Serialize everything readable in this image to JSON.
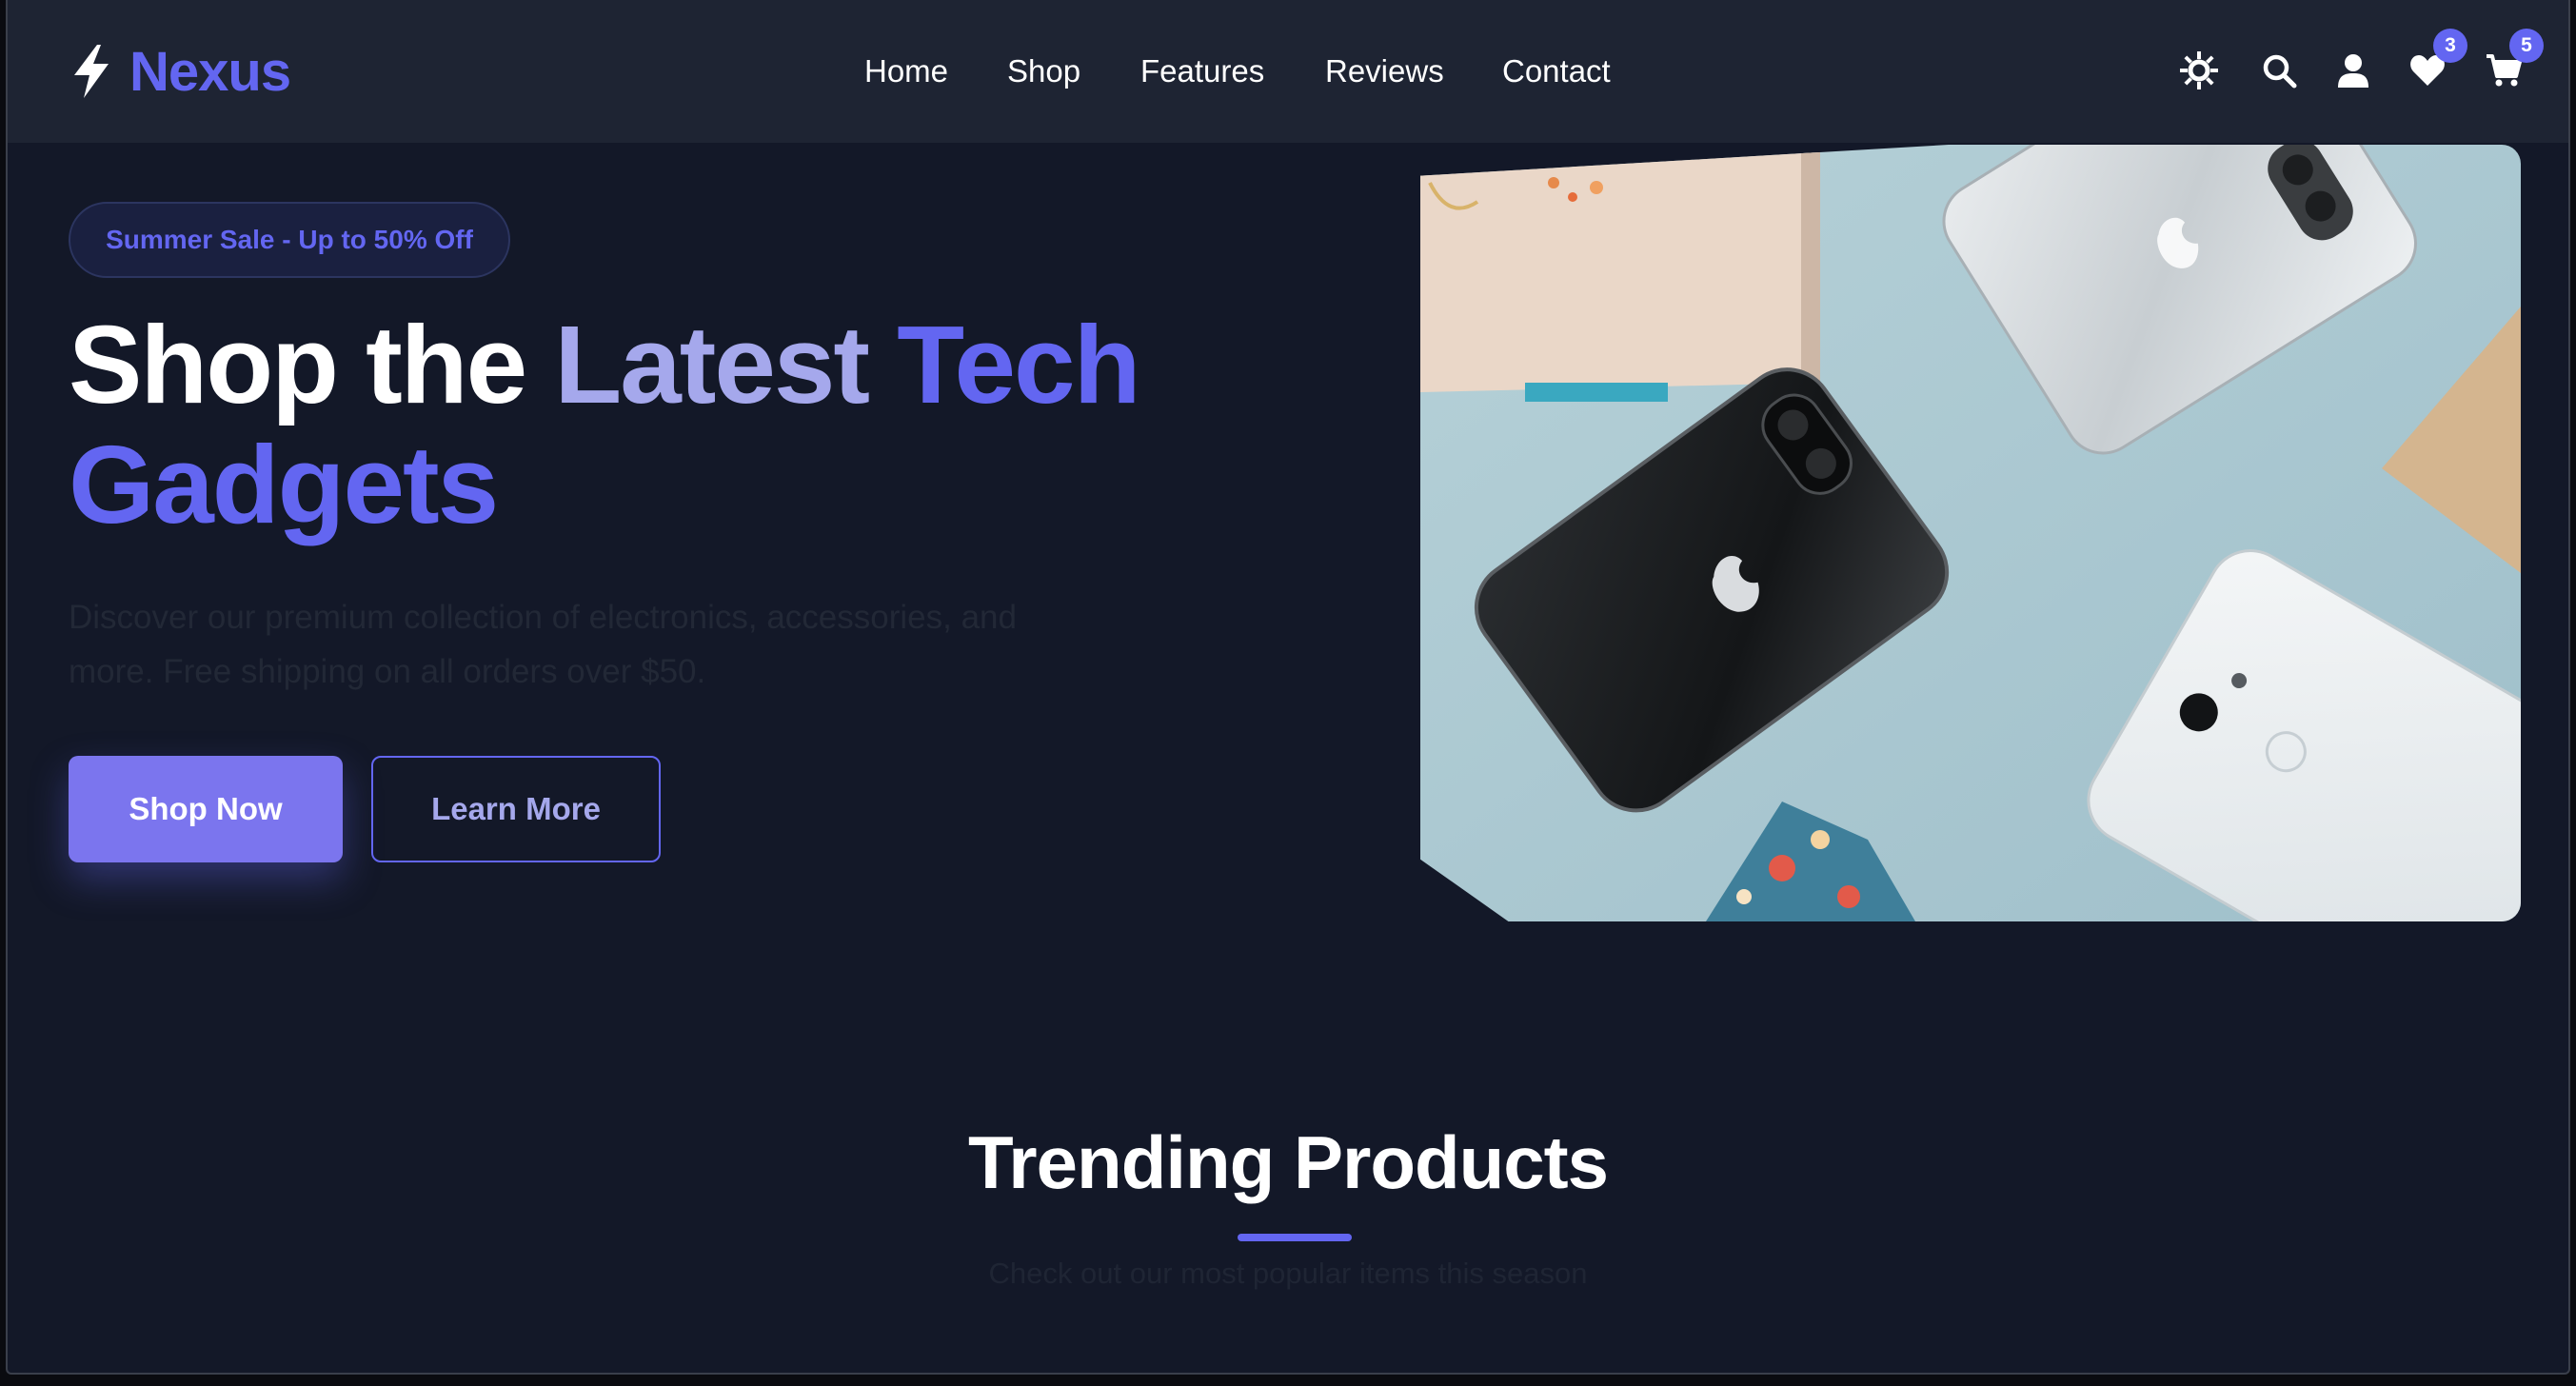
{
  "brand": {
    "name": "Nexus",
    "accent": "#6366f1"
  },
  "nav": {
    "links": [
      "Home",
      "Shop",
      "Features",
      "Reviews",
      "Contact"
    ],
    "icons": [
      "theme-toggle-icon",
      "search-icon",
      "user-icon",
      "heart-icon",
      "cart-icon"
    ],
    "wishlist_count": "3",
    "cart_count": "5"
  },
  "hero": {
    "badge": "Summer Sale - Up to 50% Off",
    "title_part1": "Shop the ",
    "title_part2": "Latest ",
    "title_part3": "Tech",
    "title_part4": "Gadgets",
    "description": "Discover our premium collection of electronics, accessories, and more. Free shipping on all orders over $50.",
    "primary_button": "Shop Now",
    "secondary_button": "Learn More"
  },
  "trending": {
    "title": "Trending Products",
    "subtitle": "Check out our most popular items this season"
  },
  "colors": {
    "background": "#131828",
    "nav_background": "#1e2433",
    "accent": "#6366f1",
    "accent_light": "#a5a8ec"
  }
}
